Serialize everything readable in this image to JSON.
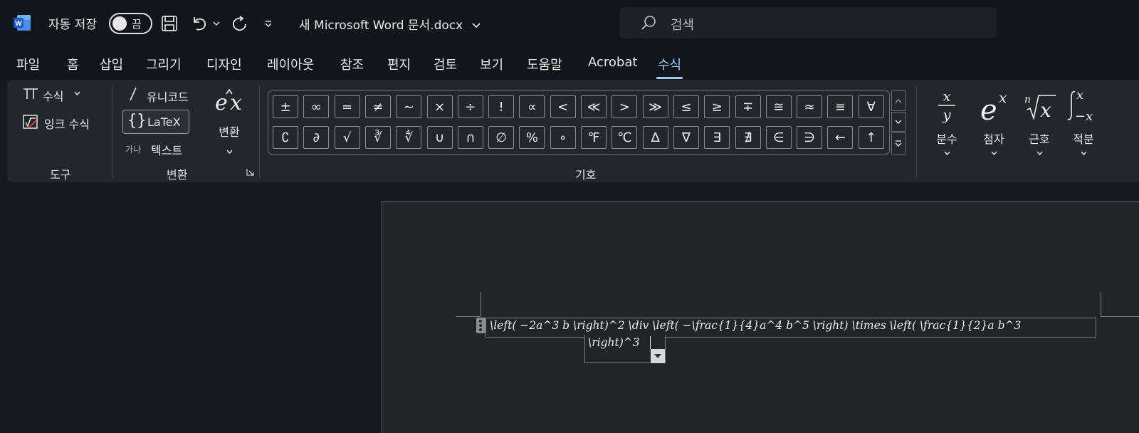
{
  "titlebar": {
    "autosave_label": "자동 저장",
    "autosave_state": "끔",
    "doc_title": "새 Microsoft Word 문서.docx",
    "search_placeholder": "검색"
  },
  "tabs": [
    {
      "label": "파일"
    },
    {
      "label": "홈"
    },
    {
      "label": "삽입"
    },
    {
      "label": "그리기"
    },
    {
      "label": "디자인"
    },
    {
      "label": "레이아웃"
    },
    {
      "label": "참조"
    },
    {
      "label": "편지"
    },
    {
      "label": "검토"
    },
    {
      "label": "보기"
    },
    {
      "label": "도움말"
    },
    {
      "label": "Acrobat"
    },
    {
      "label": "수식"
    }
  ],
  "ribbon": {
    "tools": {
      "equation_label": "수식",
      "ink_equation_label": "잉크 수식",
      "group_label": "도구"
    },
    "conversions": {
      "unicode_label": "유니코드",
      "latex_label": "LaTeX",
      "text_prefix": "가나",
      "text_label": "텍스트",
      "convert_label": "변환",
      "group_label": "변환"
    },
    "symbols": {
      "group_label": "기호",
      "row1": [
        "±",
        "∞",
        "=",
        "≠",
        "~",
        "×",
        "÷",
        "!",
        "∝",
        "<",
        "≪",
        ">",
        "≫",
        "≤",
        "≥",
        "∓",
        "≅",
        "≈",
        "≡",
        "∀"
      ],
      "row2": [
        "∁",
        "∂",
        "√",
        "∛",
        "∜",
        "∪",
        "∩",
        "∅",
        "%",
        "∘",
        "℉",
        "℃",
        "∆",
        "∇",
        "∃",
        "∄",
        "∈",
        "∋",
        "←",
        "↑"
      ]
    },
    "structures": [
      {
        "name": "분수"
      },
      {
        "name": "첨자"
      },
      {
        "name": "근호"
      },
      {
        "name": "적분"
      }
    ]
  },
  "document": {
    "equation_line1": "\\left( −2a^3 b \\right)^2 \\div \\left( −\\frac{1}{4}a^4 b^5 \\right) \\times \\left( \\frac{1}{2}a b^3",
    "equation_line2": "\\right)^3"
  }
}
